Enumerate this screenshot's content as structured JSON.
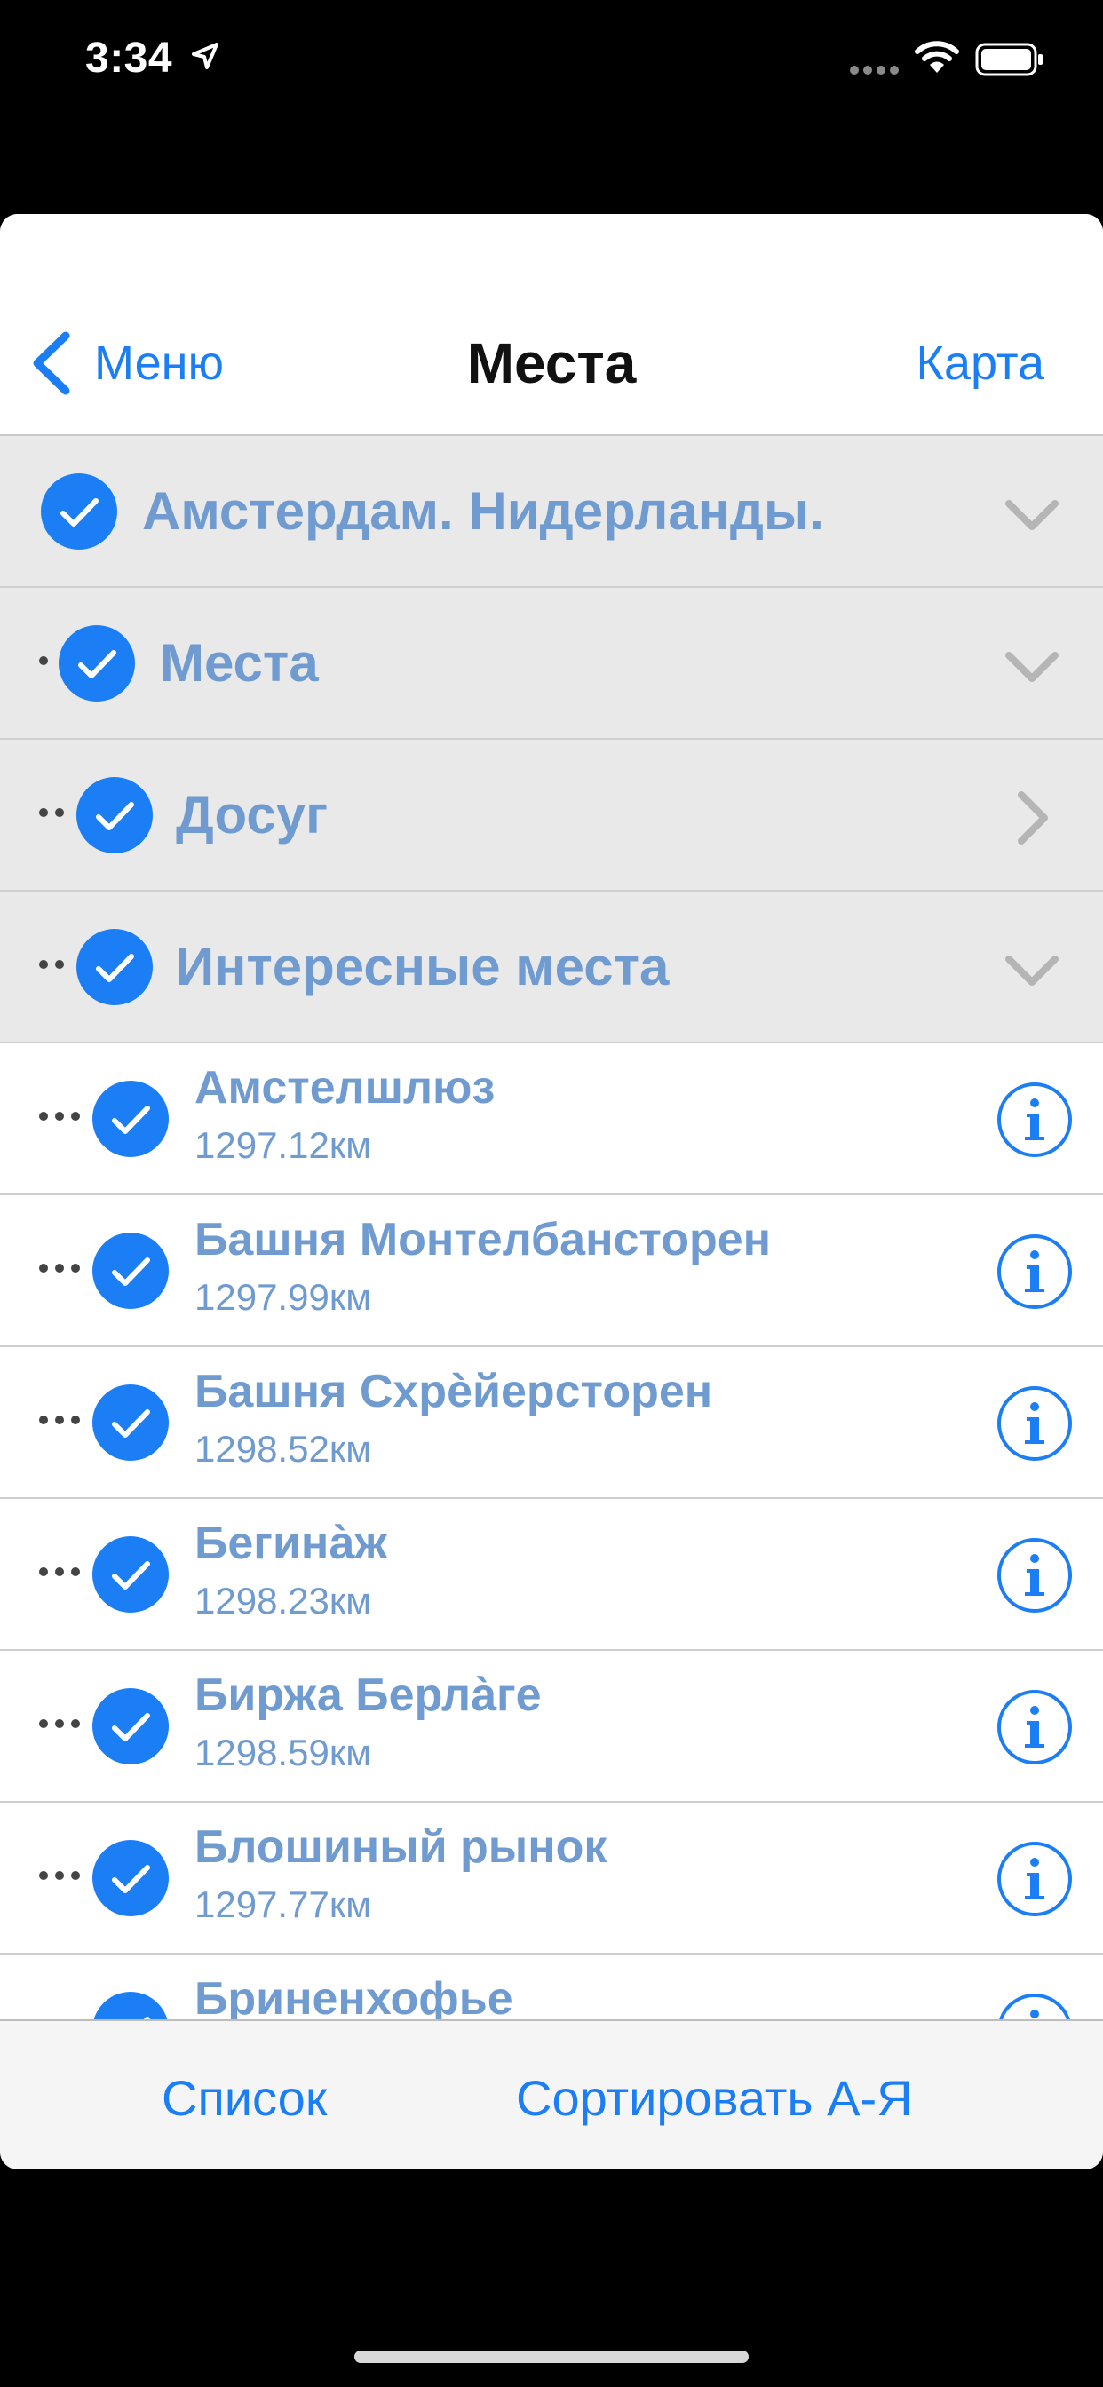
{
  "status_bar": {
    "time": "3:34"
  },
  "navbar": {
    "back_label": "Меню",
    "title": "Места",
    "right_label": "Карта"
  },
  "groups": [
    {
      "label": "Амстердам. Нидерланды.",
      "level": 0,
      "chevron": "chevron-down-icon"
    },
    {
      "label": "Места",
      "level": 1,
      "chevron": "chevron-down-icon"
    },
    {
      "label": "Досуг",
      "level": 2,
      "chevron": "chevron-right-icon"
    },
    {
      "label": "Интересные места",
      "level": 2,
      "chevron": "chevron-down-icon"
    }
  ],
  "places": [
    {
      "name": "Амстелшлюз",
      "distance": "1297.12км"
    },
    {
      "name": "Башня Монтелбансторен",
      "distance": "1297.99км"
    },
    {
      "name": "Башня Схрѐйерсторен",
      "distance": "1298.52км"
    },
    {
      "name": "Бегина̀ж",
      "distance": "1298.23км"
    },
    {
      "name": "Биржа Берла̀ге",
      "distance": "1298.59км"
    },
    {
      "name": "Блошиный рынок",
      "distance": "1297.77км"
    },
    {
      "name": "Бриненхофье",
      "distance": ""
    }
  ],
  "toolbar": {
    "list_label": "Список",
    "sort_label": "Сортировать А-Я"
  },
  "colors": {
    "accent": "#1c7ef5",
    "label": "#6f9bd0",
    "group_bg": "#e9e9e9"
  }
}
